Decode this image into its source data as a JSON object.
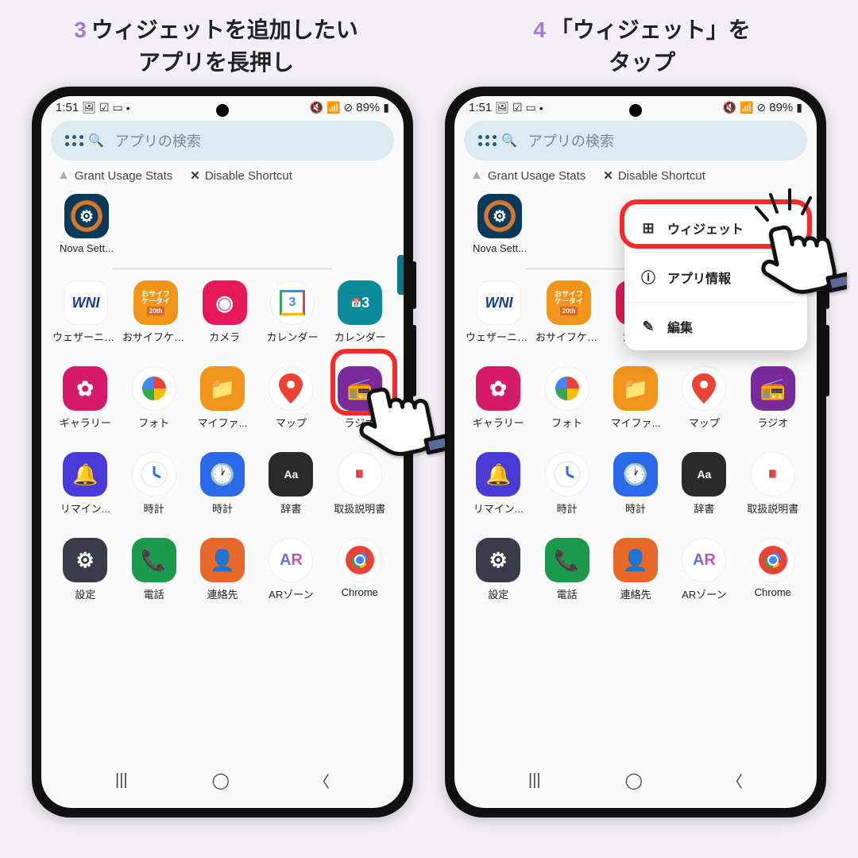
{
  "steps": [
    {
      "num": "3",
      "title_l1": "ウィジェットを追加したい",
      "title_l2": "アプリを長押し"
    },
    {
      "num": "4",
      "title_l1": "「ウィジェット」を",
      "title_l2": "タップ"
    }
  ],
  "statusbar": {
    "time": "1:51",
    "battery": "89%"
  },
  "search": {
    "placeholder": "アプリの検索"
  },
  "chips": {
    "grant": "Grant Usage Stats",
    "disable": "Disable Shortcut"
  },
  "nova": {
    "label": "Nova Sett..."
  },
  "apps_row1": [
    {
      "id": "wni",
      "label": "ウェザーニュース",
      "text": "WNI"
    },
    {
      "id": "osaifu",
      "label": "おサイフケータイ",
      "text": "おサイフ",
      "sub": "20th"
    },
    {
      "id": "camera",
      "label": "カメラ",
      "text": "◉"
    },
    {
      "id": "gcal",
      "label": "カレンダー",
      "text": "3"
    },
    {
      "id": "scal",
      "label": "カレンダー",
      "text": "📅3"
    }
  ],
  "apps_row2": [
    {
      "id": "gallery",
      "label": "ギャラリー",
      "text": "✿"
    },
    {
      "id": "photos",
      "label": "フォト",
      "text": ""
    },
    {
      "id": "files",
      "label": "マイファ...",
      "text": "📁"
    },
    {
      "id": "maps",
      "label": "マップ",
      "text": "📍"
    },
    {
      "id": "radio",
      "label": "ラジオ",
      "text": "📻"
    }
  ],
  "apps_row3": [
    {
      "id": "remind",
      "label": "リマイン...",
      "text": "🔔"
    },
    {
      "id": "clock1",
      "label": "時計",
      "text": "🕐"
    },
    {
      "id": "clock2",
      "label": "時計",
      "text": "🕐"
    },
    {
      "id": "dict",
      "label": "辞書",
      "text": "Aa"
    },
    {
      "id": "manual",
      "label": "取扱説明書",
      "text": "📕"
    }
  ],
  "apps_row4": [
    {
      "id": "settings",
      "label": "設定",
      "text": "⚙"
    },
    {
      "id": "phone",
      "label": "電話",
      "text": "📞"
    },
    {
      "id": "contacts",
      "label": "連絡先",
      "text": "👤"
    },
    {
      "id": "ar",
      "label": "ARゾーン",
      "text": "AR"
    },
    {
      "id": "chrome",
      "label": "Chrome",
      "text": ""
    }
  ],
  "context_menu": {
    "widget": "ウィジェット",
    "appinfo": "アプリ情報",
    "edit": "編集"
  }
}
